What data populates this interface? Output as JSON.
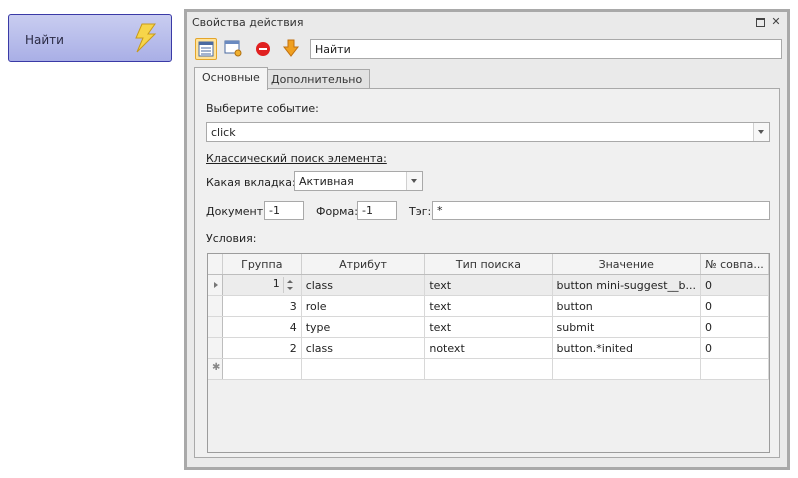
{
  "node": {
    "label": "Найти",
    "icon": "lightning-icon"
  },
  "window": {
    "title": "Свойства действия",
    "maximize_icon": "restore-icon",
    "close_glyph": "✕"
  },
  "toolbar": {
    "tools": [
      "properties-icon",
      "window-settings-icon",
      "stop-icon",
      "down-arrow-icon"
    ],
    "name_value": "Найти"
  },
  "tabs": [
    {
      "label": "Основные",
      "active": true
    },
    {
      "label": "Дополнительно",
      "active": false
    }
  ],
  "main": {
    "event_label": "Выберите событие:",
    "event_value": "click",
    "classic_search_label": "Классический поиск элемента:",
    "tab_label": "Какая вкладка:",
    "tab_value": "Активная",
    "document_label": "Документ:",
    "document_value": "-1",
    "form_label": "Форма:",
    "form_value": "-1",
    "tag_label": "Тэг:",
    "tag_value": "*",
    "conditions_label": "Условия:"
  },
  "grid": {
    "columns": [
      "Группа",
      "Атрибут",
      "Тип поиска",
      "Значение",
      "№ совпа..."
    ],
    "rows": [
      [
        "1",
        "class",
        "text",
        "button mini-suggest__b...",
        "0"
      ],
      [
        "3",
        "role",
        "text",
        "button",
        "0"
      ],
      [
        "4",
        "type",
        "text",
        "submit",
        "0"
      ],
      [
        "2",
        "class",
        "notext",
        "button.*inited",
        "0"
      ]
    ],
    "new_row_glyph": "✱"
  },
  "colors": {
    "node_border": "#3a3aa6",
    "selected_tool": "#ffe39a",
    "stop_red": "#e02020",
    "arrow_orange": "#f0a020"
  }
}
